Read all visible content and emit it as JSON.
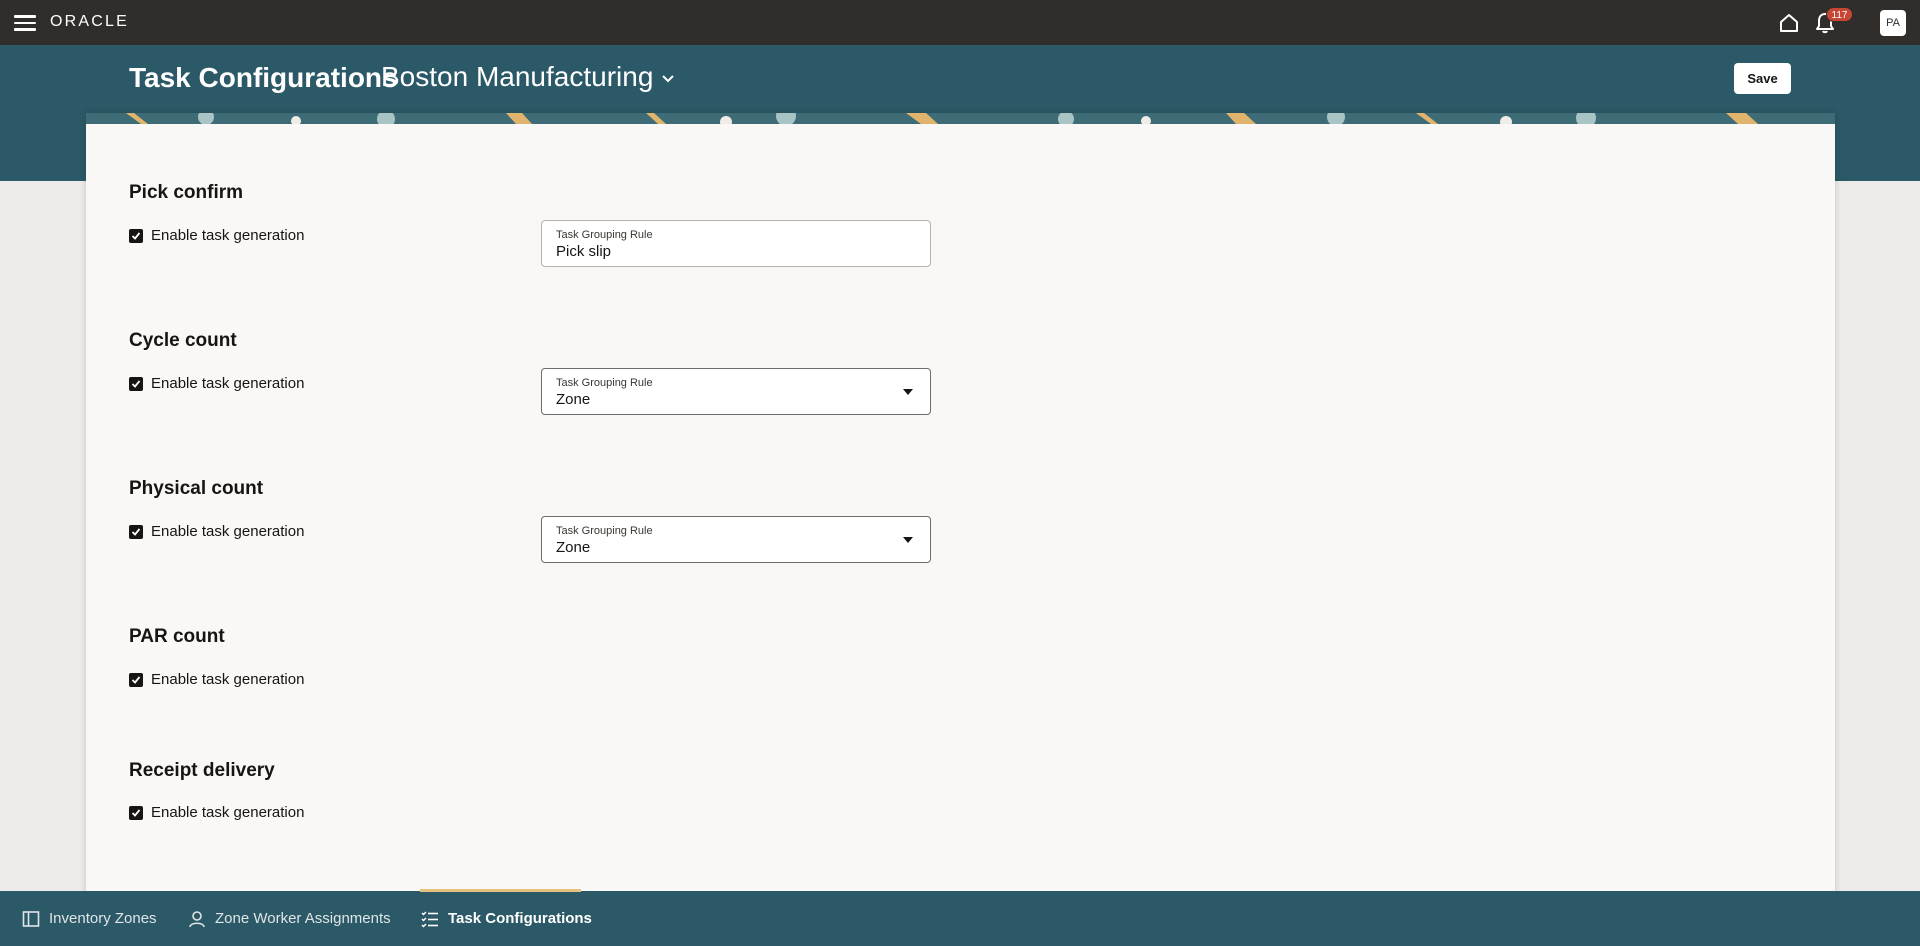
{
  "topbar": {
    "logo": "ORACLE",
    "notification_count": "117",
    "avatar_initials": "PA"
  },
  "header": {
    "title": "Task Configurations",
    "organization": "Boston Manufacturing",
    "save_label": "Save"
  },
  "sections": [
    {
      "title": "Pick confirm",
      "checkbox_label": "Enable task generation",
      "checked": true,
      "rule_label": "Task Grouping Rule",
      "rule_value": "Pick slip",
      "rule_is_select": false
    },
    {
      "title": "Cycle count",
      "checkbox_label": "Enable task generation",
      "checked": true,
      "rule_label": "Task Grouping Rule",
      "rule_value": "Zone",
      "rule_is_select": true
    },
    {
      "title": "Physical count",
      "checkbox_label": "Enable task generation",
      "checked": true,
      "rule_label": "Task Grouping Rule",
      "rule_value": "Zone",
      "rule_is_select": true
    },
    {
      "title": "PAR count",
      "checkbox_label": "Enable task generation",
      "checked": true
    },
    {
      "title": "Receipt delivery",
      "checkbox_label": "Enable task generation",
      "checked": true
    }
  ],
  "bottom_nav": [
    {
      "label": "Inventory Zones",
      "icon": "zones-icon",
      "active": false
    },
    {
      "label": "Zone Worker Assignments",
      "icon": "person-icon",
      "active": false
    },
    {
      "label": "Task Configurations",
      "icon": "checklist-icon",
      "active": true
    }
  ],
  "colors": {
    "topbar": "#312d2a",
    "header_band": "#2c5967",
    "badge": "#c74634",
    "active_tab_indicator": "#e5c27e",
    "card_background": "#f9f8f6"
  }
}
